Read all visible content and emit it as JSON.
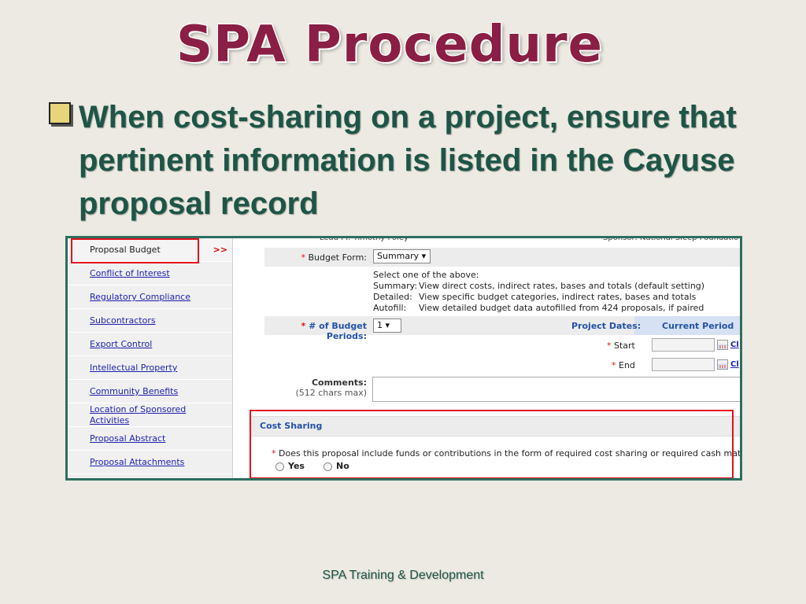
{
  "slide": {
    "title": "SPA Procedure",
    "bullet": "When cost-sharing on a project, ensure that pertinent information is listed in the Cayuse proposal record",
    "footer": "SPA Training & Development"
  },
  "sidebar": {
    "arrow": ">>",
    "items": [
      {
        "label": "Proposal Budget"
      },
      {
        "label": "Conflict of Interest"
      },
      {
        "label": "Regulatory Compliance"
      },
      {
        "label": "Subcontractors"
      },
      {
        "label": "Export Control"
      },
      {
        "label": "Intellectual Property"
      },
      {
        "label": "Community Benefits"
      },
      {
        "label": "Location of Sponsored Activities"
      },
      {
        "label": "Proposal Abstract"
      },
      {
        "label": "Proposal Attachments"
      }
    ]
  },
  "form": {
    "top_left_cut": "Lead PI:  Timothy Foley",
    "top_right_cut": "Sponsor:  National Sleep Foundatio",
    "required_mark": "*",
    "budget_form_label": "Budget Form:",
    "budget_form_value": "Summary ▾",
    "help_heading": "Select one of the above:",
    "help_rows": [
      {
        "key": "Summary:",
        "desc": "View direct costs, indirect rates, bases and totals (default setting)"
      },
      {
        "key": "Detailed:",
        "desc": "View specific budget categories, indirect rates, bases and totals"
      },
      {
        "key": "Autofill:",
        "desc": "View detailed budget data autofilled from 424 proposals, if paired"
      }
    ],
    "periods_label": "# of Budget Periods:",
    "periods_value": "1   ▾",
    "project_dates_label": "Project Dates:",
    "current_period_label": "Current Period",
    "start_label": "Start",
    "end_label": "End",
    "clear_link": "Cl",
    "comments_label": "Comments:",
    "comments_hint": "(512 chars max)",
    "cost_sharing_header": "Cost Sharing",
    "cost_sharing_question": "Does this proposal include funds or contributions in the form of required cost sharing or required cash matching?",
    "yes_label": "Yes",
    "no_label": "No"
  },
  "colors": {
    "title": "#8a1e44",
    "bullet_text": "#1d5547",
    "highlight_box": "#e3121b",
    "link": "#1e1eb0"
  }
}
